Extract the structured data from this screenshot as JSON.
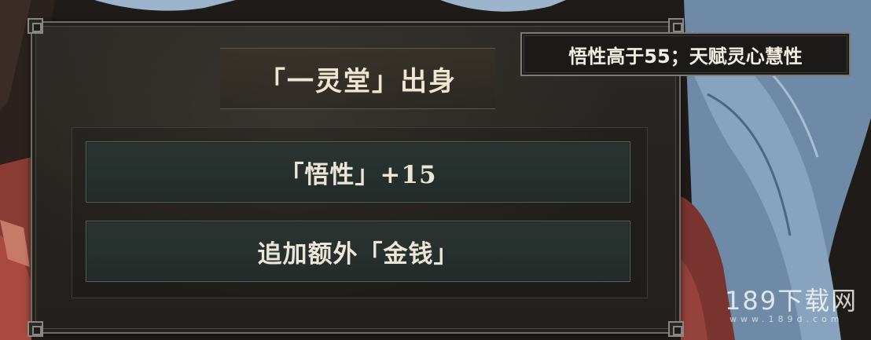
{
  "dialog": {
    "title": "「一灵堂」出身",
    "options": [
      {
        "label": "「悟性」+15"
      },
      {
        "label": "追加额外「金钱」"
      }
    ]
  },
  "tooltip": {
    "text": "悟性高于55；天赋灵心慧性"
  },
  "watermark": {
    "main": "189下载网",
    "sub": "www.189d.com"
  }
}
